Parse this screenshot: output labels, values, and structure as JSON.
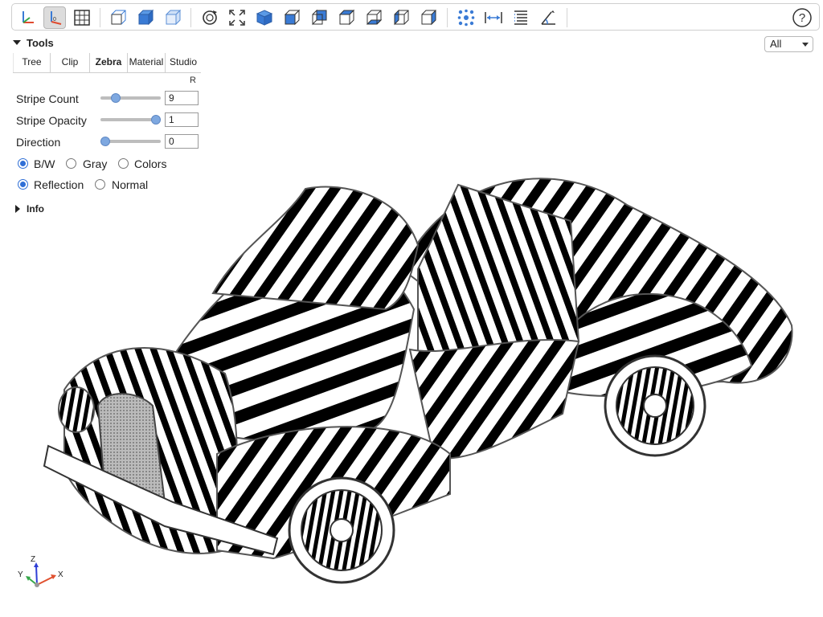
{
  "toolbar": {
    "buttons": [
      {
        "name": "axes-icon",
        "active": false
      },
      {
        "name": "axes-origin-icon",
        "active": true
      },
      {
        "name": "grid-icon",
        "active": false
      },
      {
        "name": "perspective-icon",
        "active": false
      },
      {
        "name": "transparent-icon",
        "active": false
      },
      {
        "name": "blackedges-icon",
        "active": false
      },
      {
        "name": "reset-view-icon",
        "active": false
      },
      {
        "name": "fit-view-icon",
        "active": false
      },
      {
        "name": "iso-view-icon",
        "active": false
      },
      {
        "name": "front-view-icon",
        "active": false
      },
      {
        "name": "rear-view-icon",
        "active": false
      },
      {
        "name": "top-view-icon",
        "active": false
      },
      {
        "name": "bottom-view-icon",
        "active": false
      },
      {
        "name": "left-view-icon",
        "active": false
      },
      {
        "name": "right-view-icon",
        "active": false
      },
      {
        "name": "explode-icon",
        "active": false
      },
      {
        "name": "distance-measure-icon",
        "active": false
      },
      {
        "name": "properties-icon",
        "active": false
      },
      {
        "name": "angle-measure-icon",
        "active": false
      }
    ],
    "help_icon": "help-icon"
  },
  "tools": {
    "title": "Tools",
    "tabs": [
      {
        "label": "Tree",
        "active": false
      },
      {
        "label": "Clip",
        "active": false
      },
      {
        "label": "Zebra",
        "active": true
      },
      {
        "label": "Material",
        "active": false
      },
      {
        "label": "Studio",
        "active": false
      }
    ],
    "reset_label": "R",
    "stripe_count": {
      "label": "Stripe Count",
      "value": "9",
      "slider_fraction": 0.2
    },
    "stripe_opacity": {
      "label": "Stripe Opacity",
      "value": "1",
      "slider_fraction": 1.0
    },
    "direction": {
      "label": "Direction",
      "value": "0",
      "slider_fraction": 0.0
    },
    "color_mode": {
      "options": [
        "B/W",
        "Gray",
        "Colors"
      ],
      "selected": "B/W"
    },
    "mapping_mode": {
      "options": [
        "Reflection",
        "Normal"
      ],
      "selected": "Reflection"
    }
  },
  "info": {
    "title": "Info"
  },
  "view_select": {
    "value": "All"
  },
  "axes": {
    "z": "Z",
    "y": "Y",
    "x": "X"
  },
  "colors": {
    "accent": "#2f6fd6",
    "slider_thumb": "#7ea8e0",
    "toolbar_icon_blue": "#3a7bd5"
  }
}
